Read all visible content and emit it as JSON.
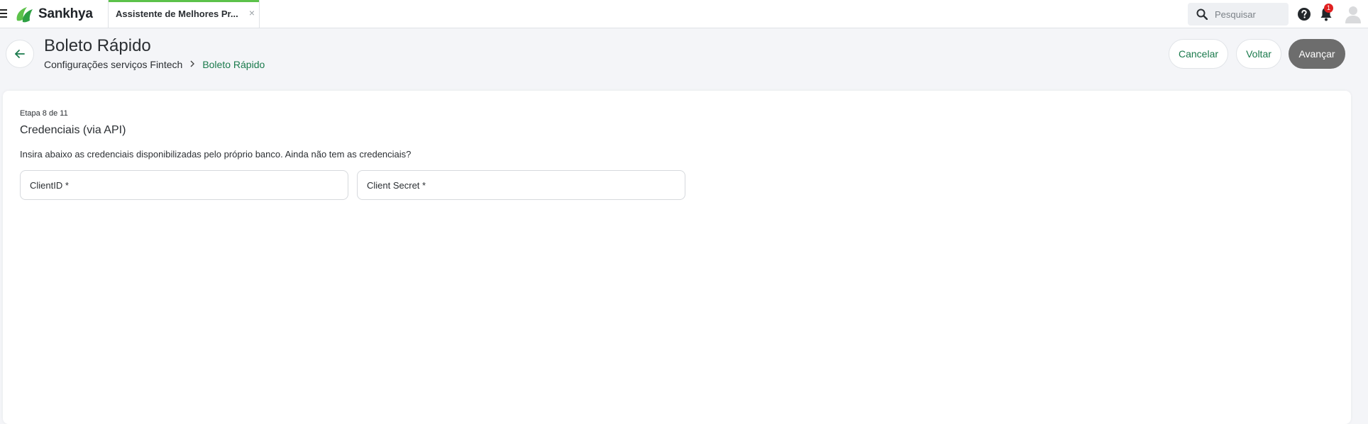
{
  "app": {
    "brand": "Sankhya"
  },
  "tab": {
    "label": "Assistente de Melhores Pr...",
    "close_symbol": "×"
  },
  "search": {
    "placeholder": "Pesquisar"
  },
  "notifications": {
    "count": "1"
  },
  "header": {
    "title": "Boleto Rápido",
    "breadcrumb": [
      {
        "label": "Configurações serviços Fintech"
      },
      {
        "label": "Boleto Rápido"
      }
    ],
    "buttons": {
      "cancel": "Cancelar",
      "back": "Voltar",
      "next": "Avançar"
    }
  },
  "step": {
    "label": "Etapa 8 de 11",
    "title": "Credenciais (via API)",
    "description": "Insira abaixo as credenciais disponibilizadas pelo próprio banco. Ainda não tem as credenciais?",
    "fields": [
      {
        "label": "ClientID *",
        "value": ""
      },
      {
        "label": "Client Secret *",
        "value": ""
      }
    ]
  },
  "colors": {
    "accent_green": "#1a7a4c",
    "tab_accent": "#5cc24a",
    "primary_button": "#6d6d6d",
    "badge": "#e02020"
  },
  "icons": [
    "menu-icon",
    "sankhya-logo-icon",
    "close-icon",
    "search-icon",
    "help-icon",
    "bell-icon",
    "user-avatar-icon",
    "arrow-left-icon",
    "chevron-right-icon"
  ]
}
